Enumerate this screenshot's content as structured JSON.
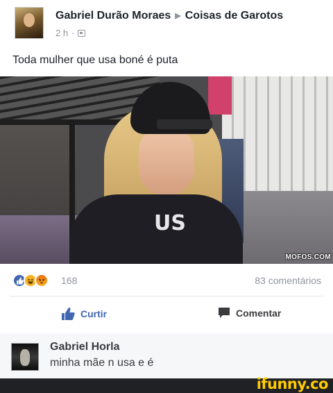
{
  "post": {
    "author": "Gabriel Durão Moraes",
    "group": "Coisas de Garotos",
    "time": "2 h",
    "separator": "·",
    "text": "Toda mulher que usa boné é puta"
  },
  "photo": {
    "hoodie_letters": "US",
    "watermark": "MOFOS.COM"
  },
  "stats": {
    "reaction_count": "168",
    "comment_count": "83 comentários"
  },
  "actions": {
    "like_label": "Curtir",
    "comment_label": "Comentar"
  },
  "comment": {
    "name": "Gabriel Horla",
    "text": "minha mãe n usa e é"
  },
  "footer": {
    "brand": "ifunny.co"
  },
  "colors": {
    "like_blue": "#4267b2",
    "meta_gray": "#90949c",
    "brand_yellow": "#ffcc00"
  }
}
